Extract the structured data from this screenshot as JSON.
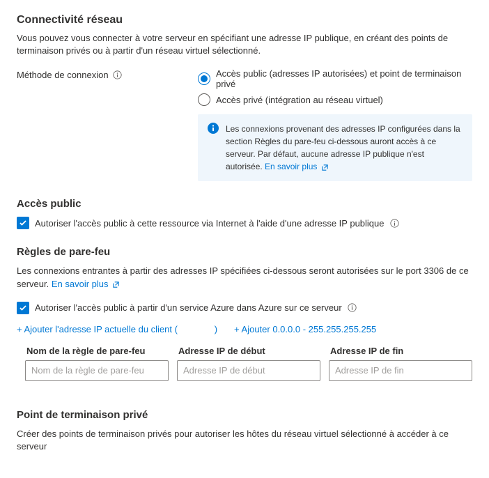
{
  "section1": {
    "title": "Connectivité réseau",
    "description": "Vous pouvez vous connecter à votre serveur en spécifiant une adresse IP publique, en créant des points de terminaison privés ou à partir d'un réseau virtuel sélectionné.",
    "method_label": "Méthode de connexion",
    "radio1": "Accès public (adresses IP autorisées) et point de terminaison privé",
    "radio2": "Accès privé (intégration au réseau virtuel)",
    "info_text": "Les connexions provenant des adresses IP configurées dans la section Règles du pare-feu ci-dessous auront accès à ce serveur. Par défaut, aucune adresse IP publique n'est autorisée. ",
    "info_link": "En savoir plus"
  },
  "section2": {
    "title": "Accès public",
    "checkbox_label": "Autoriser l'accès public à cette ressource via Internet à l'aide d'une adresse IP publique"
  },
  "section3": {
    "title": "Règles de pare-feu",
    "description": "Les connexions entrantes à partir des adresses IP spécifiées ci-dessous seront autorisées sur le port 3306 de ce serveur. ",
    "desc_link": "En savoir plus",
    "checkbox_label": "Autoriser l'accès public à partir d'un service Azure dans Azure sur ce serveur",
    "add_client_prefix": "+ Ajouter l'adresse IP actuelle du client (",
    "add_client_suffix": ")",
    "add_range": "+ Ajouter 0.0.0.0 - 255.255.255.255",
    "col1": "Nom de la règle de pare-feu",
    "col2": "Adresse IP de début",
    "col3": "Adresse IP de fin",
    "ph1": "Nom de la règle de pare-feu",
    "ph2": "Adresse IP de début",
    "ph3": "Adresse IP de fin"
  },
  "section4": {
    "title": "Point de terminaison privé",
    "description": "Créer des points de terminaison privés pour autoriser les hôtes du réseau virtuel sélectionné à accéder à ce serveur"
  }
}
